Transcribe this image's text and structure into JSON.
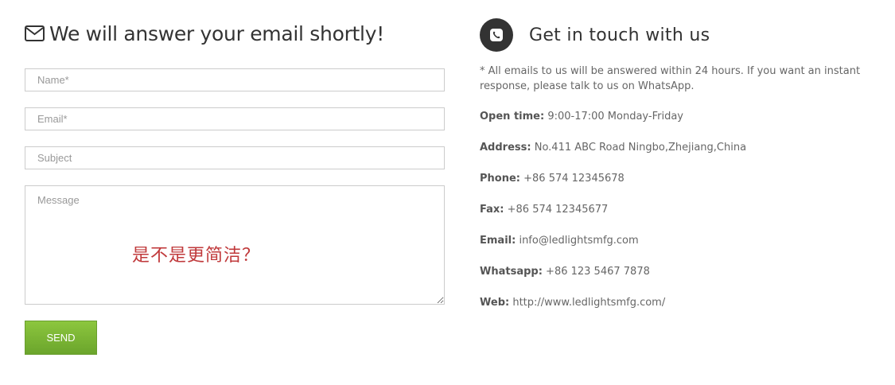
{
  "form": {
    "title": "We will answer your email shortly!",
    "name_placeholder": "Name*",
    "email_placeholder": "Email*",
    "subject_placeholder": "Subject",
    "message_placeholder": "Message",
    "watermark": "是不是更简洁？",
    "send_label": "SEND",
    "title_icon": "envelope-icon"
  },
  "contact": {
    "title": "Get in touch with us",
    "icon": "phone-icon",
    "note": "* All emails to us will be answered within 24 hours. If you want an instant response, please talk to us on WhatsApp.",
    "rows": [
      {
        "label": "Open time:",
        "value": "9:00-17:00 Monday-Friday"
      },
      {
        "label": "Address:",
        "value": "No.411 ABC Road Ningbo,Zhejiang,China"
      },
      {
        "label": "Phone:",
        "value": "+86 574 12345678"
      },
      {
        "label": "Fax:",
        "value": "+86 574 12345677"
      },
      {
        "label": "Email:",
        "value": "info@ledlightsmfg.com"
      },
      {
        "label": "Whatsapp:",
        "value": "+86 123 5467 7878"
      },
      {
        "label": "Web:",
        "value": "http://www.ledlightsmfg.com/"
      }
    ]
  },
  "colors": {
    "accent_green": "#7cb834",
    "text_dark": "#333333",
    "text_muted": "#666666",
    "watermark_red": "#c0393b"
  }
}
